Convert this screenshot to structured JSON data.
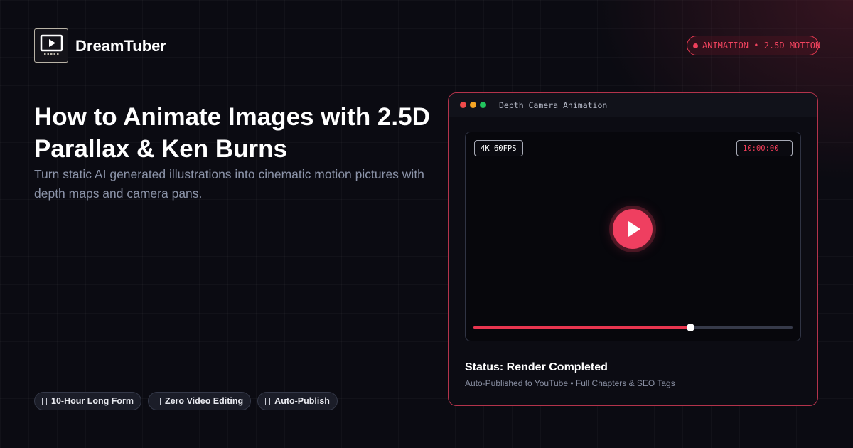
{
  "brand": {
    "name": "DreamTuber",
    "logo_icon": "video-play-icon"
  },
  "header_tag": {
    "label": "ANIMATION • 2.5D MOTION",
    "color": "#ef3f5b"
  },
  "hero": {
    "title": "How to Animate Images with 2.5D Parallax & Ken Burns",
    "subtitle": "Turn static AI generated illustrations into cinematic motion pictures with depth maps and camera pans."
  },
  "features": [
    {
      "label": "10-Hour Long Form",
      "icon": "feature-icon"
    },
    {
      "label": "Zero Video Editing",
      "icon": "feature-icon"
    },
    {
      "label": "Auto-Publish",
      "icon": "feature-icon"
    }
  ],
  "preview_window": {
    "title": "Depth Camera Animation",
    "traffic_lights": [
      "#ef4a4a",
      "#f5a524",
      "#22c55e"
    ],
    "resolution_label": "4K 60FPS",
    "timecode": "10:00:00",
    "play_icon": "play-icon",
    "progress": 0.68,
    "accent_color": "#ef3f60"
  },
  "status": {
    "title": "Status: Render Completed",
    "detail": "Auto-Published to YouTube • Full Chapters & SEO Tags"
  }
}
